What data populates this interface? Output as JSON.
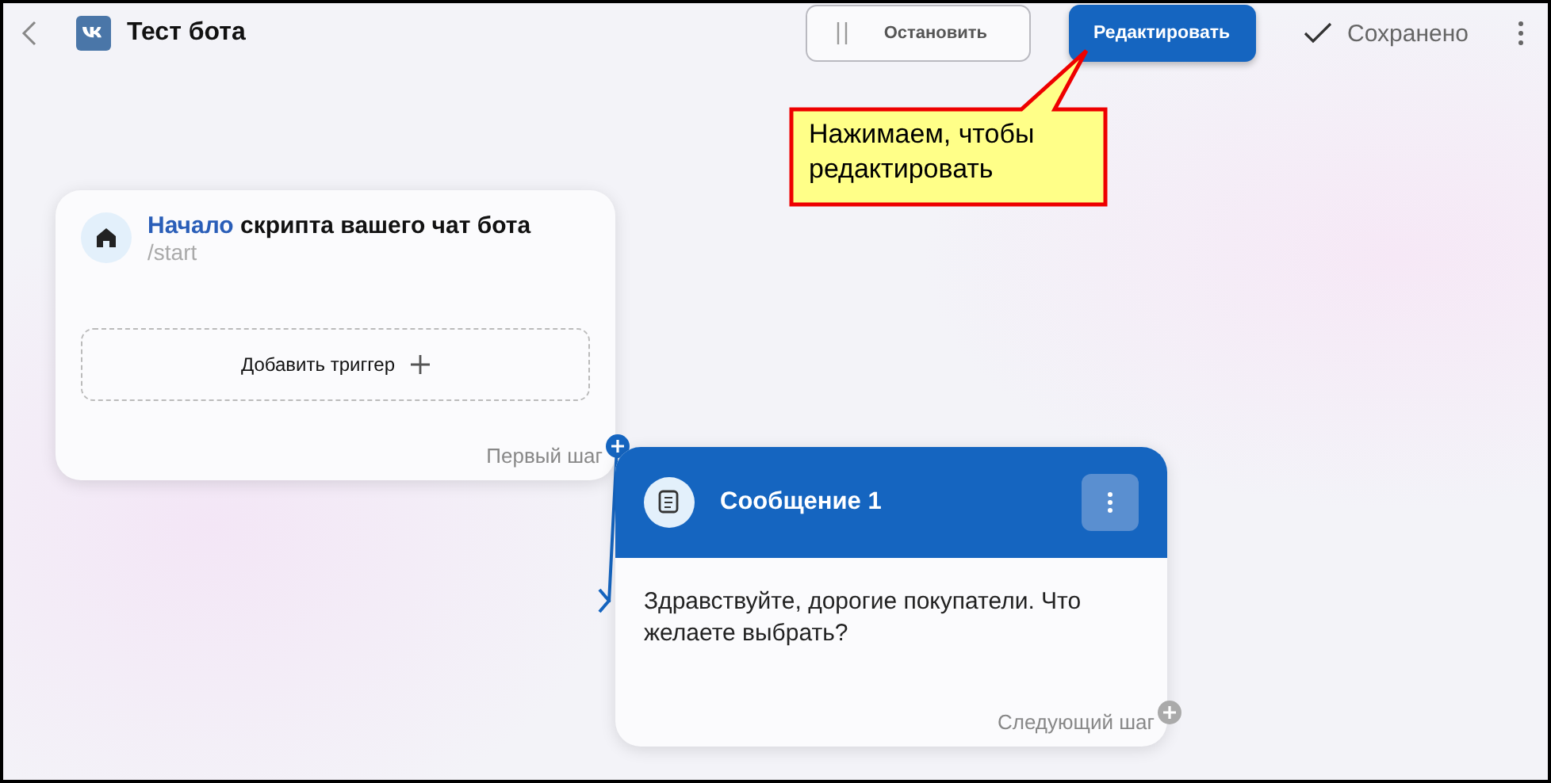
{
  "header": {
    "title": "Тест бота",
    "stop_button": "Остановить",
    "edit_button": "Редактировать",
    "status": "Сохранено"
  },
  "callout": {
    "text": "Нажимаем, чтобы редактировать"
  },
  "start_node": {
    "title_highlight": "Начало",
    "title_rest": "скрипта вашего чат бота",
    "command": "/start",
    "add_trigger": "Добавить триггер",
    "next_label": "Первый шаг"
  },
  "message_node": {
    "title": "Сообщение 1",
    "text": "Здравствуйте, дорогие покупатели. Что желаете выбрать?",
    "next_label": "Следующий шаг"
  }
}
